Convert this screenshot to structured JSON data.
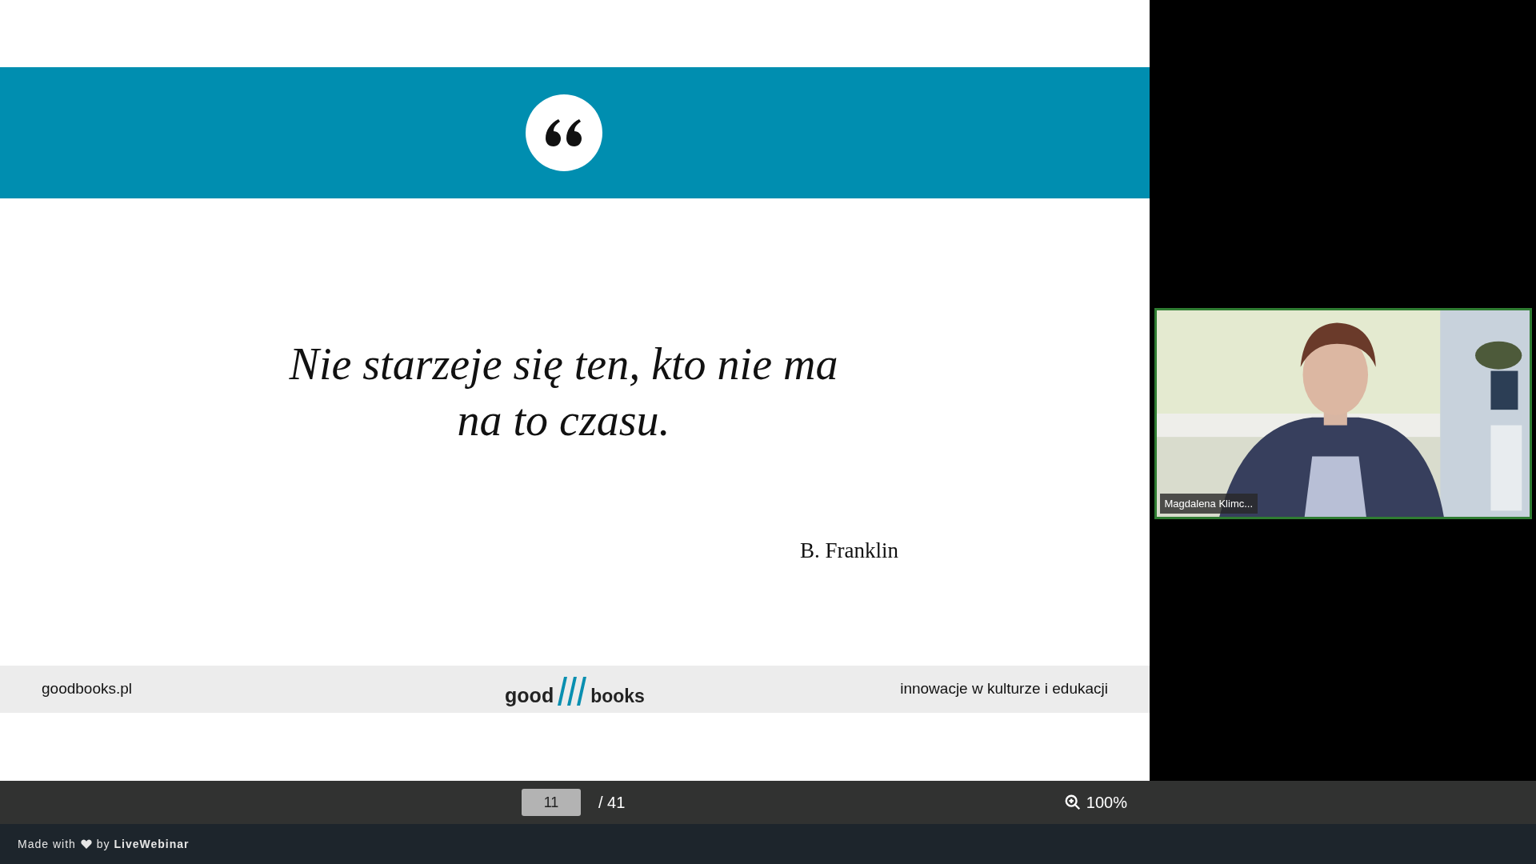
{
  "slide": {
    "quote_lines": [
      "Nie starzeje się ten, kto nie ma",
      "na to czasu."
    ],
    "author": "B. Franklin",
    "footer": {
      "website": "goodbooks.pl",
      "logo_left": "good",
      "logo_right": "books",
      "tagline": "innowacje w kulturze i edukacji"
    }
  },
  "toolbar": {
    "page": "11",
    "total": "/ 41",
    "zoom": "100%"
  },
  "video": {
    "kind": "picture",
    "name": "Magdalena Klimc...",
    "speaking": true
  },
  "branding": {
    "made_with": "Made with",
    "by": "by **LiveWebinar**"
  }
}
